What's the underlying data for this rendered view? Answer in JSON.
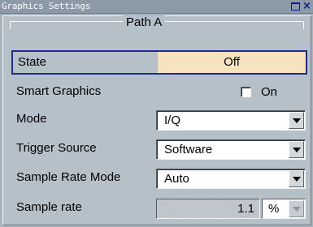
{
  "window": {
    "title": "Graphics Settings",
    "maximize_icon": "maximize-icon",
    "close_icon": "close-icon",
    "close_glyph": "×"
  },
  "group": {
    "title": "Path A"
  },
  "state": {
    "label": "State",
    "value": "Off",
    "highlight_color": "#f6e2be",
    "focus_color": "#1d2c8e"
  },
  "smart_graphics": {
    "label": "Smart Graphics",
    "checked": false,
    "check_label": "On"
  },
  "mode": {
    "label": "Mode",
    "value": "I/Q"
  },
  "trigger_source": {
    "label": "Trigger Source",
    "value": "Software"
  },
  "sample_rate_mode": {
    "label": "Sample Rate Mode",
    "value": "Auto"
  },
  "sample_rate": {
    "label": "Sample rate",
    "value": "1.1",
    "unit": "%"
  }
}
